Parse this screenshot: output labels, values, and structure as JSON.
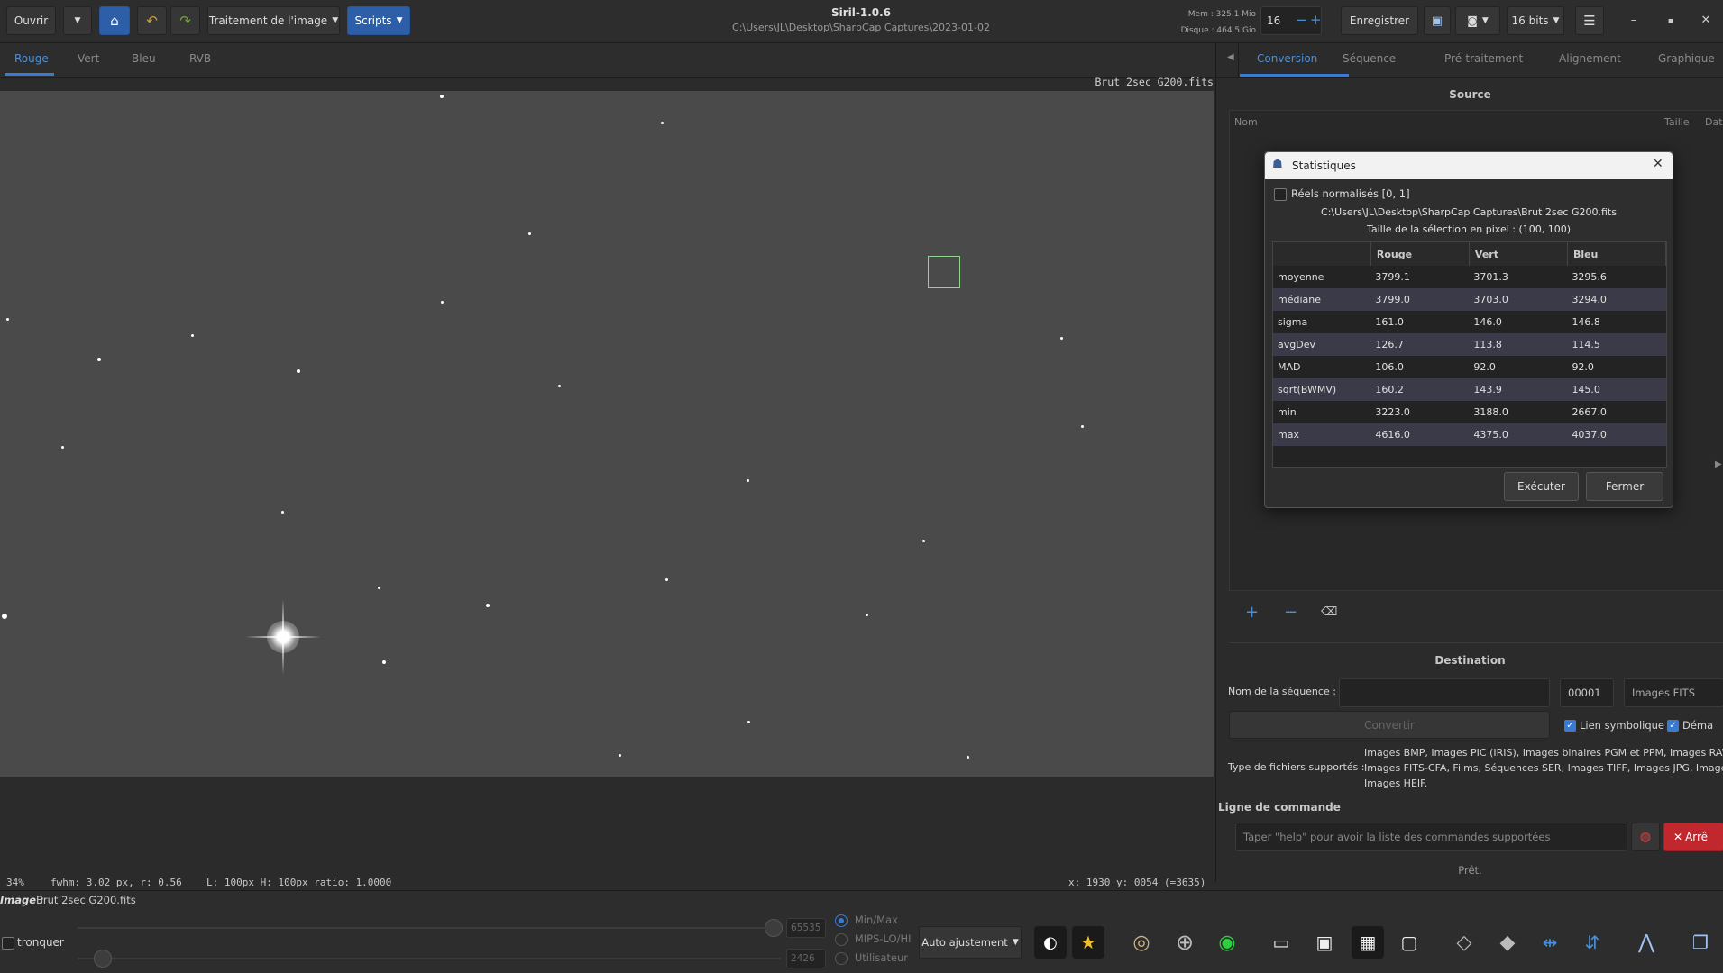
{
  "header": {
    "open_label": "Ouvrir",
    "image_processing_label": "Traitement de l'image",
    "scripts_label": "Scripts",
    "app_title": "Siril-1.0.6",
    "working_dir": "C:\\Users\\JL\\Desktop\\SharpCap Captures\\2023-01-02",
    "mem_label": "Mem : 325.1 Mio",
    "disk_label": "Disque : 464.5 Gio",
    "threads_value": "16",
    "save_label": "Enregistrer",
    "bitdepth_label": "16 bits"
  },
  "channel_tabs": [
    "Rouge",
    "Vert",
    "Bleu",
    "RVB"
  ],
  "image": {
    "filename_overlay": "Brut 2sec G200.fits"
  },
  "status": {
    "zoom": "34%",
    "fwhm": "fwhm: 3.02 px, r: 0.56",
    "selection": "L: 100px H: 100px ratio: 1.0000",
    "coords": "x: 1930 y: 0054 (=3635)"
  },
  "bottom": {
    "image_label": "Image :",
    "image_value": "Brut 2sec G200.fits",
    "clip_label": "tronquer",
    "high_value": "65535",
    "low_value": "2426",
    "scale_options": [
      "Min/Max",
      "MIPS-LO/HI",
      "Utilisateur"
    ],
    "stretch_label": "Auto ajustement"
  },
  "right_tabs": [
    "Conversion",
    "Séquence",
    "Pré-traitement",
    "Alignement",
    "Graphique"
  ],
  "conversion": {
    "source_title": "Source",
    "col_name": "Nom",
    "col_size": "Taille",
    "col_date": "Dat",
    "destination_title": "Destination",
    "seq_name_label": "Nom de la séquence :",
    "seq_number": "00001",
    "format_value": "Images FITS",
    "convert_label": "Convertir",
    "symlink_label": "Lien symbolique",
    "debayer_label": "Déma",
    "types_label": "Type de fichiers supportés :",
    "types_lines": [
      "Images BMP, Images PIC (IRIS), Images binaires PGM et PPM, Images RAW",
      "Images FITS-CFA, Films, Séquences SER, Images TIFF, Images JPG, Images P",
      "Images HEIF."
    ]
  },
  "command": {
    "title": "Ligne de commande",
    "placeholder": "Taper \"help\" pour avoir la liste des commandes supportées",
    "stop_label": "Arrê",
    "status": "Prêt."
  },
  "stats_dialog": {
    "title": "Statistiques",
    "normalized_label": "Réels normalisés [0, 1]",
    "file_path": "C:\\Users\\JL\\Desktop\\SharpCap Captures\\Brut 2sec G200.fits",
    "selection_size": "Taille de la sélection en pixel : (100, 100)",
    "columns": [
      "",
      "Rouge",
      "Vert",
      "Bleu"
    ],
    "rows": [
      [
        "moyenne",
        "3799.1",
        "3701.3",
        "3295.6"
      ],
      [
        "médiane",
        "3799.0",
        "3703.0",
        "3294.0"
      ],
      [
        "sigma",
        "161.0",
        "146.0",
        "146.8"
      ],
      [
        "avgDev",
        "126.7",
        "113.8",
        "114.5"
      ],
      [
        "MAD",
        "106.0",
        "92.0",
        "92.0"
      ],
      [
        "sqrt(BWMV)",
        "160.2",
        "143.9",
        "145.0"
      ],
      [
        "min",
        "3223.0",
        "3188.0",
        "2667.0"
      ],
      [
        "max",
        "4616.0",
        "4375.0",
        "4037.0"
      ]
    ],
    "run_label": "Exécuter",
    "close_label": "Fermer"
  }
}
